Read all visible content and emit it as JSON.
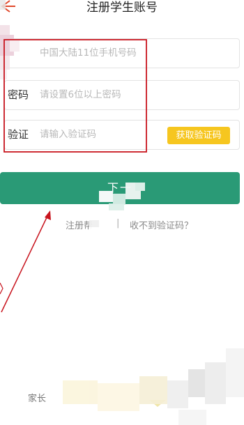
{
  "header": {
    "title": "注册学生账号",
    "back_icon": "back-arrow-icon"
  },
  "form": {
    "phone": {
      "label": "",
      "placeholder": "中国大陆11位手机号码"
    },
    "password": {
      "label": "密码",
      "placeholder": "请设置6位以上密码"
    },
    "code": {
      "label": "验证",
      "placeholder": "请输入验证码",
      "button_label": "获取验证码"
    }
  },
  "next_button": {
    "label": "下一"
  },
  "links": {
    "help_label": "注册帮",
    "separator": "|",
    "no_code_label": "收不到验证码？"
  },
  "bottom": {
    "text": "家长"
  },
  "colors": {
    "primary": "#2a9a76",
    "accent": "#f6c61f",
    "annotation": "#c8141e",
    "back_arrow": "#e0482b"
  }
}
